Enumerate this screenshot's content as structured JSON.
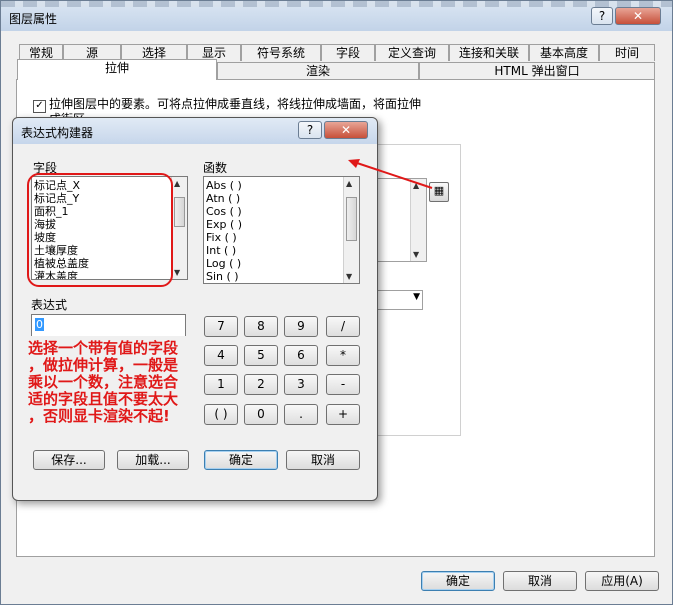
{
  "outer": {
    "title": "图层属性",
    "help_label": "?",
    "close_label": "✕"
  },
  "tabs_row1": [
    "常规",
    "源",
    "选择",
    "显示",
    "符号系统",
    "字段",
    "定义查询",
    "连接和关联",
    "基本高度",
    "时间"
  ],
  "tabs_row2": [
    "拉伸",
    "渲染",
    "HTML 弹出窗口"
  ],
  "extrude": {
    "checkbox_label_line1": "拉伸图层中的要素。可将点拉伸成垂直线，将线拉伸成墙面，将面拉伸",
    "checkbox_label_line2": "成街区。",
    "checked": true
  },
  "footer": {
    "ok": "确定",
    "cancel": "取消",
    "apply": "应用(A)"
  },
  "dialog": {
    "title": "表达式构建器",
    "help_label": "?",
    "close_label": "✕",
    "fields_label": "字段",
    "fields": [
      "标记点_X",
      "标记点_Y",
      "面积_1",
      "海拔",
      "坡度",
      "土壤厚度",
      "植被总盖度",
      "灌木盖度"
    ],
    "functions_label": "函数",
    "functions": [
      "Abs ( )",
      "Atn ( )",
      "Cos ( )",
      "Exp ( )",
      "Fix ( )",
      "Int ( )",
      "Log ( )",
      "Sin ( )"
    ],
    "expression_label": "表达式",
    "expression_value": "0",
    "keys": [
      "7",
      "8",
      "9",
      "/",
      "4",
      "5",
      "6",
      "*",
      "1",
      "2",
      "3",
      "-",
      "( )",
      "0",
      ".",
      "+"
    ],
    "save": "保存...",
    "load": "加载...",
    "ok": "确定",
    "cancel": "取消"
  },
  "annotation": {
    "line1": "选择一个带有值的字段",
    "line2": "，做拉伸计算，一般是",
    "line3": "乘以一个数，注意选合",
    "line4": "适的字段且值不要太大",
    "line5": "，否则显卡渲染不起!"
  },
  "colors": {
    "annotation": "#e01818",
    "title_bar": "#c6d6eb"
  }
}
